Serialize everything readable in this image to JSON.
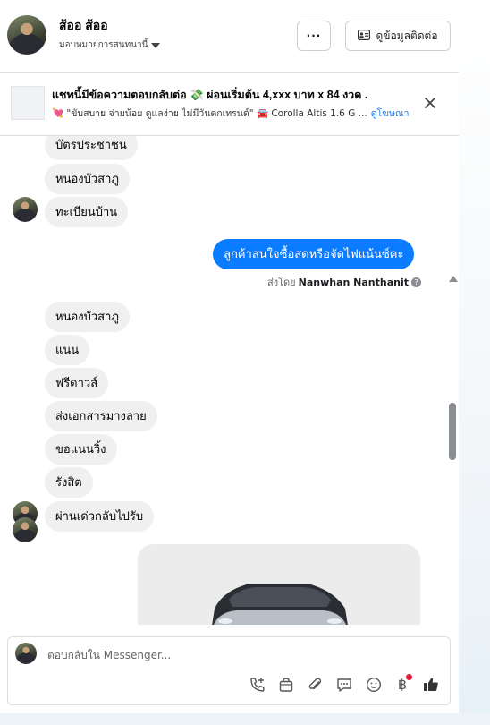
{
  "header": {
    "contact_name": "ส้ออ ส้ออ",
    "assign_label": "มอบหมายการสนทนานี้",
    "more_label": "···",
    "view_contact_label": "ดูข้อมูลติดต่อ"
  },
  "ad_banner": {
    "title": "แชทนี้มีข้อความตอบกลับต่อ 💸 ผ่อนเริ่มต้น 4,xxx บาท x 84 งวด .",
    "subtitle": "💘 \"ขับสบาย จ่ายน้อย ดูแลง่าย ไม่มีวันตกเทรนด์\" 🚘 Corolla Altis 1.6 G ...",
    "link": "ดูโฆษณา"
  },
  "messages": [
    {
      "side": "in",
      "text": "บัตรประชาชน"
    },
    {
      "side": "in",
      "text": "หนองบัวสาภู"
    },
    {
      "side": "in",
      "text": "ทะเบียนบ้าน"
    },
    {
      "side": "out",
      "text": "ลูกค้าสนใจซื้อสดหรือจัดไฟแน้นซ์คะ"
    },
    {
      "side": "in",
      "text": "หนองบัวสาภู"
    },
    {
      "side": "in",
      "text": "แนน"
    },
    {
      "side": "in",
      "text": "ฟรีดาวส์"
    },
    {
      "side": "in",
      "text": "ส่งเอกสารมางลาย"
    },
    {
      "side": "in",
      "text": "ขอแนนวิ้ง"
    },
    {
      "side": "in",
      "text": "รังสิต"
    },
    {
      "side": "in",
      "text": "ผ่านเด่วกลับไปรับ"
    }
  ],
  "sent_by": {
    "prefix": "ส่งโดย",
    "name": "Nanwhan Nanthanit",
    "help": "?"
  },
  "composer": {
    "placeholder": "ตอบกลับใน Messenger...",
    "currency_symbol": "฿"
  },
  "icons": [
    "more-icon",
    "contact-card-icon",
    "close-icon",
    "help-icon",
    "add-call-icon",
    "shop-bag-icon",
    "attach-icon",
    "saved-reply-icon",
    "emoji-icon",
    "baht-icon",
    "thumbs-up-icon"
  ],
  "colors": {
    "outgoing_bubble": "#0a7cff",
    "incoming_bubble": "#f0f0f0",
    "link": "#1877f2",
    "like": "#1877f2",
    "notification_dot": "#e41e3f"
  }
}
